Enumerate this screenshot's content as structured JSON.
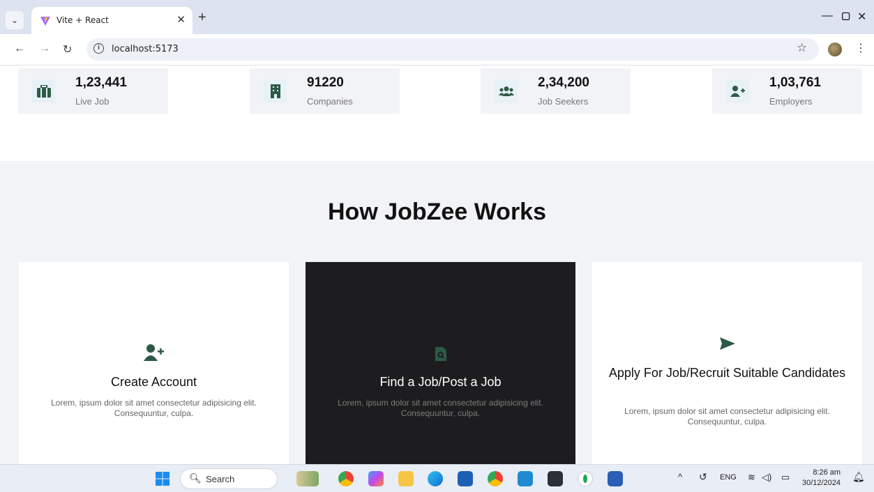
{
  "browser": {
    "tab_title": "Vite + React",
    "url": "localhost:5173"
  },
  "stats": [
    {
      "value": "1,23,441",
      "label": "Live Job",
      "icon": "briefcase-icon"
    },
    {
      "value": "91220",
      "label": "Companies",
      "icon": "building-icon"
    },
    {
      "value": "2,34,200",
      "label": "Job Seekers",
      "icon": "users-icon"
    },
    {
      "value": "1,03,761",
      "label": "Employers",
      "icon": "user-plus-icon"
    }
  ],
  "how": {
    "title": "How JobZee Works",
    "cards": [
      {
        "title": "Create Account",
        "text": "Lorem, ipsum dolor sit amet consectetur adipisicing elit. Consequuntur, culpa.",
        "icon": "user-plus-icon"
      },
      {
        "title": "Find a Job/Post a Job",
        "text": "Lorem, ipsum dolor sit amet consectetur adipisicing elit. Consequuntur, culpa.",
        "icon": "file-search-icon"
      },
      {
        "title": "Apply For Job/Recruit Suitable Candidates",
        "text": "Lorem, ipsum dolor sit amet consectetur adipisicing elit. Consequuntur, culpa.",
        "icon": "send-icon"
      }
    ]
  },
  "taskbar": {
    "search_label": "Search",
    "language": "ENG",
    "time": "8:26 am",
    "date": "30/12/2024"
  },
  "colors": {
    "accent_green": "#2d5a46",
    "dark_card": "#1d1d1f",
    "section_bg": "#f2f3f6"
  }
}
